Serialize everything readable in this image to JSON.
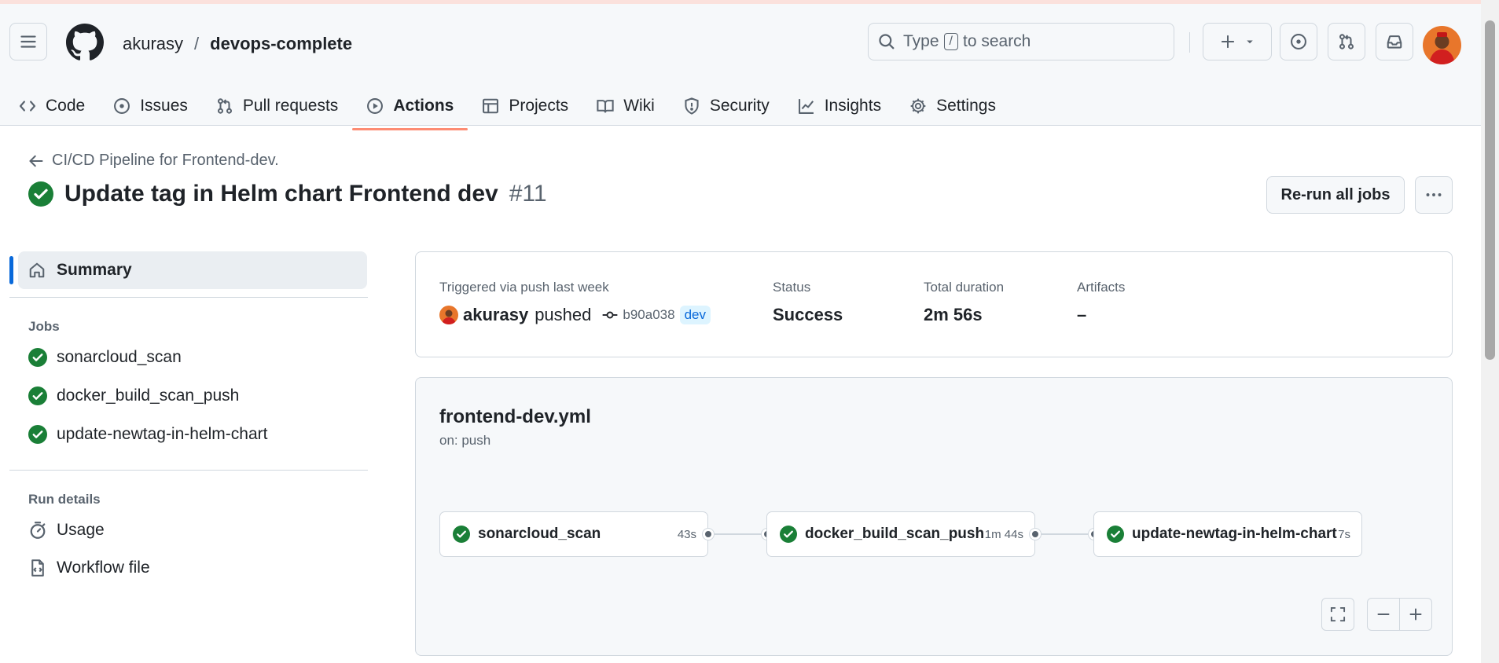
{
  "header": {
    "owner": "akurasy",
    "separator": "/",
    "repo": "devops-complete",
    "search_prefix": "Type",
    "search_key": "/",
    "search_suffix": "to search"
  },
  "tabs": [
    {
      "label": "Code",
      "icon": "code-icon"
    },
    {
      "label": "Issues",
      "icon": "issue-opened-icon"
    },
    {
      "label": "Pull requests",
      "icon": "git-pull-request-icon"
    },
    {
      "label": "Actions",
      "icon": "play-icon",
      "active": true
    },
    {
      "label": "Projects",
      "icon": "table-icon"
    },
    {
      "label": "Wiki",
      "icon": "book-icon"
    },
    {
      "label": "Security",
      "icon": "shield-icon"
    },
    {
      "label": "Insights",
      "icon": "graph-icon"
    },
    {
      "label": "Settings",
      "icon": "gear-icon"
    }
  ],
  "run": {
    "back_label": "CI/CD Pipeline for Frontend-dev.",
    "title": "Update tag in Helm chart Frontend dev",
    "number": "#11",
    "rerun_label": "Re-run all jobs"
  },
  "sidebar": {
    "summary_label": "Summary",
    "jobs_heading": "Jobs",
    "jobs": [
      "sonarcloud_scan",
      "docker_build_scan_push",
      "update-newtag-in-helm-chart"
    ],
    "details_heading": "Run details",
    "usage_label": "Usage",
    "workflow_file_label": "Workflow file"
  },
  "summary": {
    "triggered_label": "Triggered via push last week",
    "actor": "akurasy",
    "action": "pushed",
    "commit": "b90a038",
    "branch": "dev",
    "status_label": "Status",
    "status_value": "Success",
    "duration_label": "Total duration",
    "duration_value": "2m 56s",
    "artifacts_label": "Artifacts",
    "artifacts_value": "–"
  },
  "graph": {
    "workflow_file": "frontend-dev.yml",
    "trigger": "on: push",
    "jobs": [
      {
        "name": "sonarcloud_scan",
        "duration": "43s"
      },
      {
        "name": "docker_build_scan_push",
        "duration": "1m 44s"
      },
      {
        "name": "update-newtag-in-helm-chart",
        "duration": "7s"
      }
    ]
  },
  "colors": {
    "success": "#1a7f37",
    "active_tab_underline": "#fd8c73",
    "accent": "#0969da"
  }
}
